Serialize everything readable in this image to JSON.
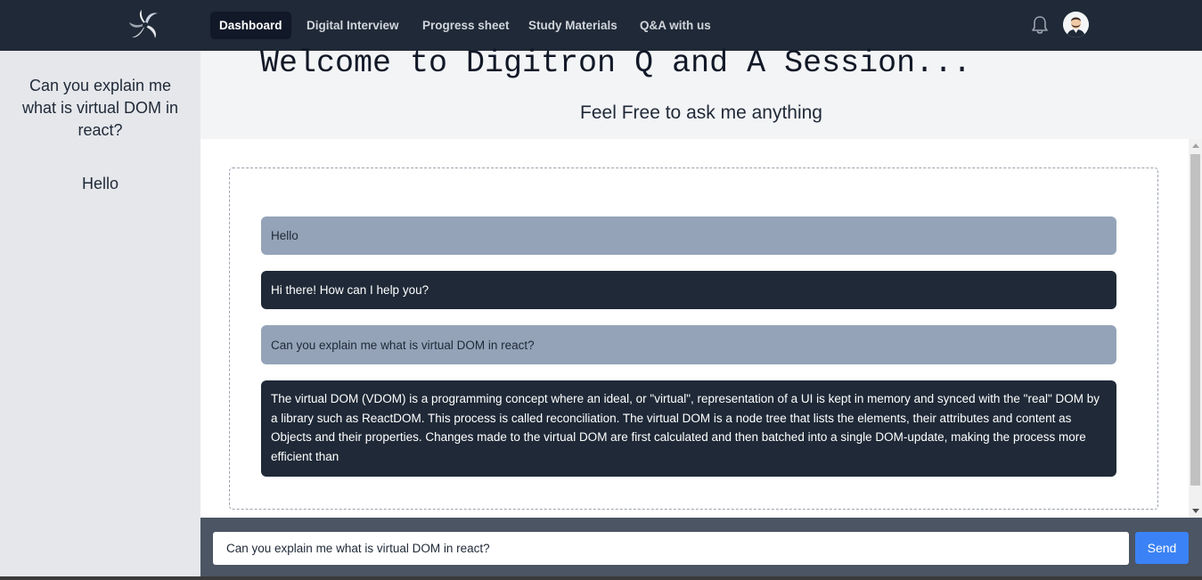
{
  "navbar": {
    "logo_icon": "spiral-logo-icon",
    "links": [
      {
        "label": "Dashboard",
        "active": true
      },
      {
        "label": "Digital Interview",
        "active": false
      },
      {
        "label": "Progress sheet",
        "active": false
      },
      {
        "label": "Study Materials",
        "active": false
      },
      {
        "label": "Q&A with us",
        "active": false
      }
    ],
    "bell_icon": "bell-icon",
    "avatar_icon": "user-avatar-icon"
  },
  "sidebar": {
    "items": [
      {
        "label": "Can you explain me what is virtual DOM in react?"
      },
      {
        "label": "Hello"
      }
    ]
  },
  "main": {
    "welcome": "Welcome to Digitron Q and A Session...",
    "subtitle": "Feel Free to ask me anything"
  },
  "chat": {
    "messages": [
      {
        "role": "user",
        "text": "Hello"
      },
      {
        "role": "bot",
        "text": "Hi there! How can I help you?"
      },
      {
        "role": "user",
        "text": "Can you explain me what is virtual DOM in react?"
      },
      {
        "role": "bot",
        "text": "The virtual DOM (VDOM) is a programming concept where an ideal, or \"virtual\", representation of a UI is kept in memory and synced with the \"real\" DOM by a library such as ReactDOM. This process is called reconciliation. The virtual DOM is a node tree that lists the elements, their attributes and content as Objects and their properties. Changes made to the virtual DOM are first calculated and then batched into a single DOM-update, making the process more efficient than"
      }
    ]
  },
  "input": {
    "value": "Can you explain me what is virtual DOM in react?",
    "send_label": "Send"
  },
  "colors": {
    "navbar": "#1f2937",
    "user_bubble": "#94a3b8",
    "bot_bubble": "#1f2937",
    "send_button": "#3b82f6",
    "input_bar": "#4b5563"
  }
}
